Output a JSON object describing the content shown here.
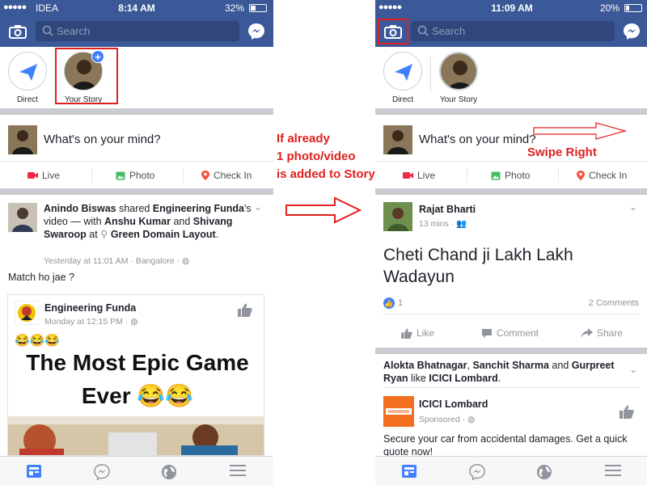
{
  "annotation": {
    "condition_lines": [
      "If already",
      "1 photo/video",
      "is added to Story"
    ],
    "swipe_label": "Swipe Right"
  },
  "left": {
    "status": {
      "signal": "●●●●●",
      "carrier": "IDEA",
      "time": "8:14 AM",
      "battery": "32%",
      "battery_level": 0.32
    },
    "search_placeholder": "Search",
    "stories": [
      {
        "label": "Direct"
      },
      {
        "label": "Your Story"
      }
    ],
    "composer_placeholder": "What's on your mind?",
    "actions": [
      "Live",
      "Photo",
      "Check In"
    ],
    "post": {
      "author": "Anindo Biswas",
      "verb1": " shared ",
      "page": "Engineering Funda",
      "verb2": "'s video — with ",
      "with1": "Anshu Kumar",
      "and": " and ",
      "with2": "Shivang Swaroop",
      "at": " at ",
      "place": "Green Domain Layout",
      "end": ".",
      "meta": "Yesterday at 11:01 AM · Bangalore · ",
      "text": "Match ho jae ?",
      "shared": {
        "name": "Engineering Funda",
        "meta": "Monday at 12:15 PM · ",
        "emoji": "😂😂😂",
        "video_title_1": "The Most Epic Game",
        "video_title_2": "Ever 😂😂"
      }
    }
  },
  "right": {
    "status": {
      "signal": "●●●●●",
      "carrier": "",
      "time": "11:09 AM",
      "battery": "20%",
      "battery_level": 0.2
    },
    "search_placeholder": "Search",
    "stories": [
      {
        "label": "Direct"
      },
      {
        "label": "Your Story"
      }
    ],
    "composer_placeholder": "What's on your mind?",
    "actions": [
      "Live",
      "Photo",
      "Check In"
    ],
    "post": {
      "author": "Rajat Bharti",
      "meta": "13 mins · ",
      "text": "Cheti Chand ji Lakh Lakh Wadayun",
      "likes": "1",
      "comments": "2 Comments",
      "buttons": [
        "Like",
        "Comment",
        "Share"
      ]
    },
    "ad": {
      "friends1": "Alokta Bhatnagar",
      "comma": ", ",
      "friends2": "Sanchit Sharma",
      "and": " and ",
      "friends3": "Gurpreet Ryan",
      "like": " like ",
      "page": "ICICI Lombard",
      "end": ".",
      "name": "ICICI Lombard",
      "sponsored": "Sponsored · ",
      "text": "Secure your car from accidental damages. Get a quick quote now!"
    }
  },
  "colors": {
    "fb_blue": "#3b5998",
    "annotation_red": "#e02020",
    "link_blue": "#4080ff"
  }
}
